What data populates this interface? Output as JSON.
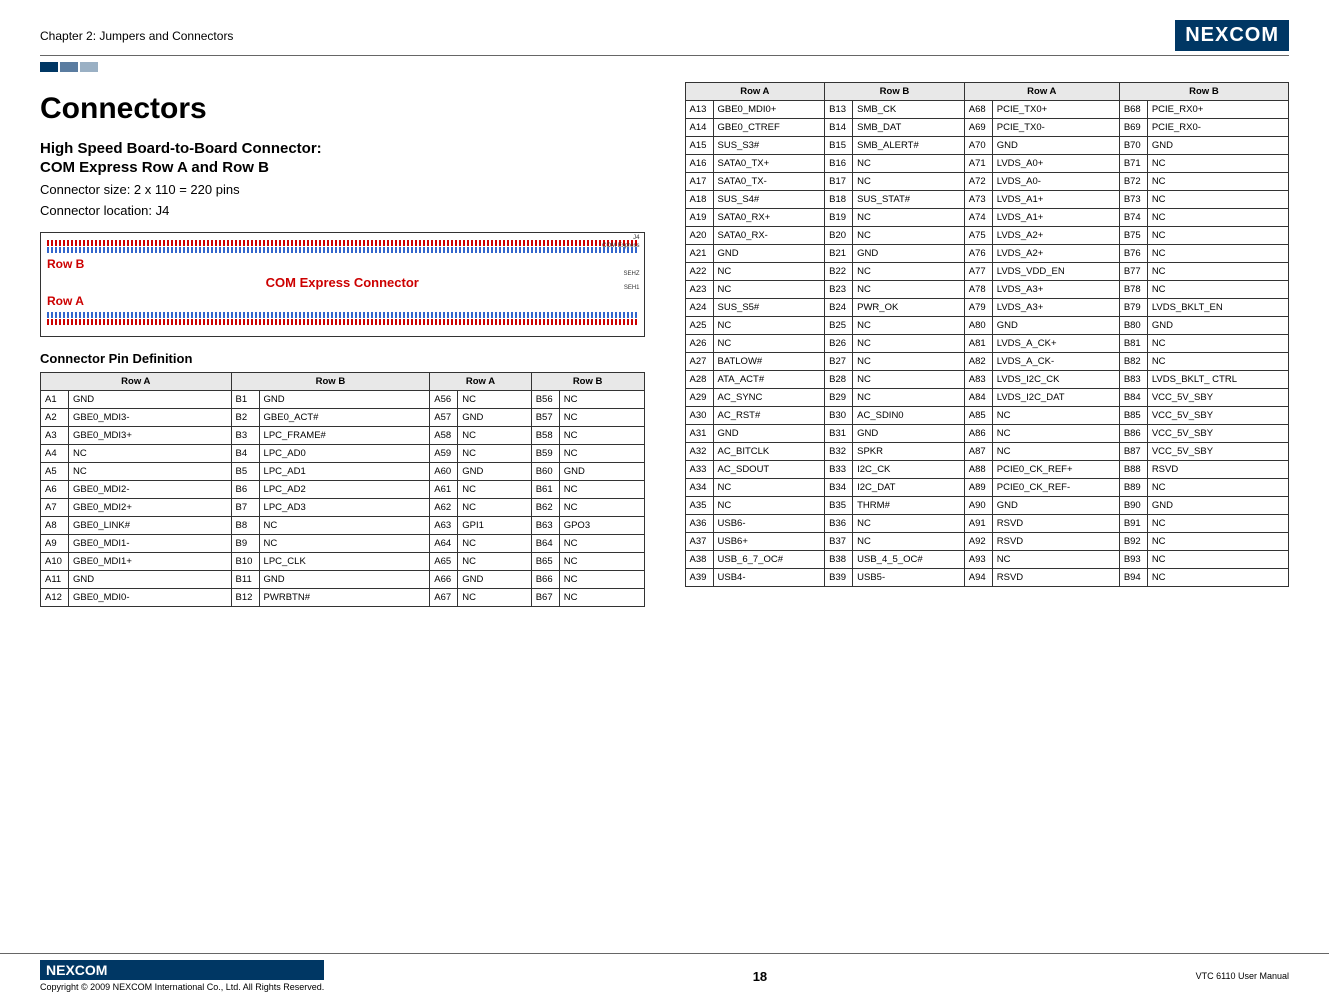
{
  "header": {
    "chapter": "Chapter 2: Jumpers and Connectors",
    "logo": "NEXCOM"
  },
  "title": "Connectors",
  "subtitle1": "High Speed Board-to-Board Connector:",
  "subtitle2": "COM Express Row A and Row B",
  "note1": "Connector size: 2 x 110 = 220 pins",
  "note2": "Connector location: J4",
  "diagram": {
    "rowB": "Row B",
    "rowA": "Row A",
    "connector": "COM Express Connector",
    "j4": "J4",
    "com_exp": "COM Express",
    "sehz": "SEHZ",
    "seh1": "SEH1"
  },
  "defn": "Connector Pin Definition",
  "headers": {
    "rowA": "Row A",
    "rowB": "Row B"
  },
  "table1": [
    {
      "a": "A1",
      "as": "GND",
      "b": "B1",
      "bs": "GND",
      "a2": "A56",
      "a2s": "NC",
      "b2": "B56",
      "b2s": "NC"
    },
    {
      "a": "A2",
      "as": "GBE0_MDI3-",
      "b": "B2",
      "bs": "GBE0_ACT#",
      "a2": "A57",
      "a2s": "GND",
      "b2": "B57",
      "b2s": "NC"
    },
    {
      "a": "A3",
      "as": "GBE0_MDI3+",
      "b": "B3",
      "bs": "LPC_FRAME#",
      "a2": "A58",
      "a2s": "NC",
      "b2": "B58",
      "b2s": "NC"
    },
    {
      "a": "A4",
      "as": "NC",
      "b": "B4",
      "bs": "LPC_AD0",
      "a2": "A59",
      "a2s": "NC",
      "b2": "B59",
      "b2s": "NC"
    },
    {
      "a": "A5",
      "as": "NC",
      "b": "B5",
      "bs": "LPC_AD1",
      "a2": "A60",
      "a2s": "GND",
      "b2": "B60",
      "b2s": "GND"
    },
    {
      "a": "A6",
      "as": "GBE0_MDI2-",
      "b": "B6",
      "bs": "LPC_AD2",
      "a2": "A61",
      "a2s": "NC",
      "b2": "B61",
      "b2s": "NC"
    },
    {
      "a": "A7",
      "as": "GBE0_MDI2+",
      "b": "B7",
      "bs": "LPC_AD3",
      "a2": "A62",
      "a2s": "NC",
      "b2": "B62",
      "b2s": "NC"
    },
    {
      "a": "A8",
      "as": "GBE0_LINK#",
      "b": "B8",
      "bs": "NC",
      "a2": "A63",
      "a2s": "GPI1",
      "b2": "B63",
      "b2s": "GPO3"
    },
    {
      "a": "A9",
      "as": "GBE0_MDI1-",
      "b": "B9",
      "bs": "NC",
      "a2": "A64",
      "a2s": "NC",
      "b2": "B64",
      "b2s": "NC"
    },
    {
      "a": "A10",
      "as": "GBE0_MDI1+",
      "b": "B10",
      "bs": "LPC_CLK",
      "a2": "A65",
      "a2s": "NC",
      "b2": "B65",
      "b2s": "NC"
    },
    {
      "a": "A11",
      "as": "GND",
      "b": "B11",
      "bs": "GND",
      "a2": "A66",
      "a2s": "GND",
      "b2": "B66",
      "b2s": "NC"
    },
    {
      "a": "A12",
      "as": "GBE0_MDI0-",
      "b": "B12",
      "bs": "PWRBTN#",
      "a2": "A67",
      "a2s": "NC",
      "b2": "B67",
      "b2s": "NC"
    }
  ],
  "table2": [
    {
      "a": "A13",
      "as": "GBE0_MDI0+",
      "b": "B13",
      "bs": "SMB_CK",
      "a2": "A68",
      "a2s": "PCIE_TX0+",
      "b2": "B68",
      "b2s": "PCIE_RX0+"
    },
    {
      "a": "A14",
      "as": "GBE0_CTREF",
      "b": "B14",
      "bs": "SMB_DAT",
      "a2": "A69",
      "a2s": "PCIE_TX0-",
      "b2": "B69",
      "b2s": "PCIE_RX0-"
    },
    {
      "a": "A15",
      "as": "SUS_S3#",
      "b": "B15",
      "bs": "SMB_ALERT#",
      "a2": "A70",
      "a2s": "GND",
      "b2": "B70",
      "b2s": "GND"
    },
    {
      "a": "A16",
      "as": "SATA0_TX+",
      "b": "B16",
      "bs": "NC",
      "a2": "A71",
      "a2s": "LVDS_A0+",
      "b2": "B71",
      "b2s": "NC"
    },
    {
      "a": "A17",
      "as": "SATA0_TX-",
      "b": "B17",
      "bs": "NC",
      "a2": "A72",
      "a2s": "LVDS_A0-",
      "b2": "B72",
      "b2s": "NC"
    },
    {
      "a": "A18",
      "as": "SUS_S4#",
      "b": "B18",
      "bs": "SUS_STAT#",
      "a2": "A73",
      "a2s": "LVDS_A1+",
      "b2": "B73",
      "b2s": "NC"
    },
    {
      "a": "A19",
      "as": "SATA0_RX+",
      "b": "B19",
      "bs": "NC",
      "a2": "A74",
      "a2s": "LVDS_A1+",
      "b2": "B74",
      "b2s": "NC"
    },
    {
      "a": "A20",
      "as": "SATA0_RX-",
      "b": "B20",
      "bs": "NC",
      "a2": "A75",
      "a2s": "LVDS_A2+",
      "b2": "B75",
      "b2s": "NC"
    },
    {
      "a": "A21",
      "as": "GND",
      "b": "B21",
      "bs": "GND",
      "a2": "A76",
      "a2s": "LVDS_A2+",
      "b2": "B76",
      "b2s": "NC"
    },
    {
      "a": "A22",
      "as": "NC",
      "b": "B22",
      "bs": "NC",
      "a2": "A77",
      "a2s": "LVDS_VDD_EN",
      "b2": "B77",
      "b2s": "NC"
    },
    {
      "a": "A23",
      "as": "NC",
      "b": "B23",
      "bs": "NC",
      "a2": "A78",
      "a2s": "LVDS_A3+",
      "b2": "B78",
      "b2s": "NC"
    },
    {
      "a": "A24",
      "as": "SUS_S5#",
      "b": "B24",
      "bs": "PWR_OK",
      "a2": "A79",
      "a2s": "LVDS_A3+",
      "b2": "B79",
      "b2s": "LVDS_BKLT_EN"
    },
    {
      "a": "A25",
      "as": "NC",
      "b": "B25",
      "bs": "NC",
      "a2": "A80",
      "a2s": "GND",
      "b2": "B80",
      "b2s": "GND"
    },
    {
      "a": "A26",
      "as": "NC",
      "b": "B26",
      "bs": "NC",
      "a2": "A81",
      "a2s": "LVDS_A_CK+",
      "b2": "B81",
      "b2s": "NC"
    },
    {
      "a": "A27",
      "as": "BATLOW#",
      "b": "B27",
      "bs": "NC",
      "a2": "A82",
      "a2s": "LVDS_A_CK-",
      "b2": "B82",
      "b2s": "NC"
    },
    {
      "a": "A28",
      "as": "ATA_ACT#",
      "b": "B28",
      "bs": "NC",
      "a2": "A83",
      "a2s": "LVDS_I2C_CK",
      "b2": "B83",
      "b2s": "LVDS_BKLT_ CTRL"
    },
    {
      "a": "A29",
      "as": "AC_SYNC",
      "b": "B29",
      "bs": "NC",
      "a2": "A84",
      "a2s": "LVDS_I2C_DAT",
      "b2": "B84",
      "b2s": "VCC_5V_SBY"
    },
    {
      "a": "A30",
      "as": "AC_RST#",
      "b": "B30",
      "bs": "AC_SDIN0",
      "a2": "A85",
      "a2s": "NC",
      "b2": "B85",
      "b2s": "VCC_5V_SBY"
    },
    {
      "a": "A31",
      "as": "GND",
      "b": "B31",
      "bs": "GND",
      "a2": "A86",
      "a2s": "NC",
      "b2": "B86",
      "b2s": "VCC_5V_SBY"
    },
    {
      "a": "A32",
      "as": "AC_BITCLK",
      "b": "B32",
      "bs": "SPKR",
      "a2": "A87",
      "a2s": "NC",
      "b2": "B87",
      "b2s": "VCC_5V_SBY"
    },
    {
      "a": "A33",
      "as": "AC_SDOUT",
      "b": "B33",
      "bs": "I2C_CK",
      "a2": "A88",
      "a2s": "PCIE0_CK_REF+",
      "b2": "B88",
      "b2s": "RSVD"
    },
    {
      "a": "A34",
      "as": "NC",
      "b": "B34",
      "bs": "I2C_DAT",
      "a2": "A89",
      "a2s": "PCIE0_CK_REF-",
      "b2": "B89",
      "b2s": "NC"
    },
    {
      "a": "A35",
      "as": "NC",
      "b": "B35",
      "bs": "THRM#",
      "a2": "A90",
      "a2s": "GND",
      "b2": "B90",
      "b2s": "GND"
    },
    {
      "a": "A36",
      "as": "USB6-",
      "b": "B36",
      "bs": "NC",
      "a2": "A91",
      "a2s": "RSVD",
      "b2": "B91",
      "b2s": "NC"
    },
    {
      "a": "A37",
      "as": "USB6+",
      "b": "B37",
      "bs": "NC",
      "a2": "A92",
      "a2s": "RSVD",
      "b2": "B92",
      "b2s": "NC"
    },
    {
      "a": "A38",
      "as": "USB_6_7_OC#",
      "b": "B38",
      "bs": "USB_4_5_OC#",
      "a2": "A93",
      "a2s": "NC",
      "b2": "B93",
      "b2s": "NC"
    },
    {
      "a": "A39",
      "as": "USB4-",
      "b": "B39",
      "bs": "USB5-",
      "a2": "A94",
      "a2s": "RSVD",
      "b2": "B94",
      "b2s": "NC"
    }
  ],
  "footer": {
    "logo": "NEXCOM",
    "copyright": "Copyright © 2009 NEXCOM International Co., Ltd. All Rights Reserved.",
    "page": "18",
    "manual": "VTC 6110 User Manual"
  }
}
